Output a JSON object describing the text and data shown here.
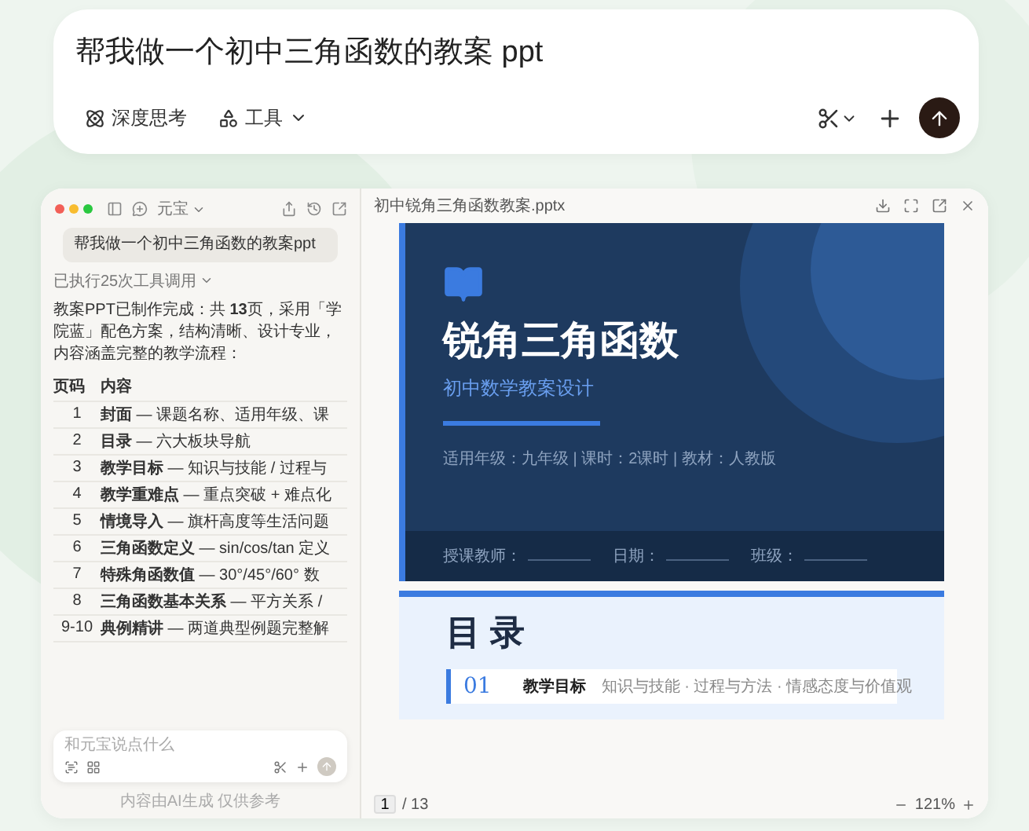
{
  "prompt": {
    "value": "帮我做一个初中三角函数的教案 ppt",
    "tools": [
      {
        "kind": "toggle",
        "label": "深度思考"
      },
      {
        "kind": "menu",
        "label": "工具"
      }
    ]
  },
  "chat": {
    "app_label": "元宝",
    "message": "帮我做一个初中三角函数的教案ppt",
    "tool_calls": "已执行25次工具调用",
    "summary": "教案PPT已制作完成：共 **13**页，采用「学院蓝」配色方案，结构清晰、设计专业，内容涵盖完整的教学流程：",
    "columns": [
      "页码",
      "内容"
    ],
    "rows": [
      {
        "page": "1",
        "title": "封面",
        "detail": " — 课题名称、适用年级、课"
      },
      {
        "page": "2",
        "title": "目录",
        "detail": " — 六大板块导航"
      },
      {
        "page": "3",
        "title": "教学目标",
        "detail": " — 知识与技能 / 过程与"
      },
      {
        "page": "4",
        "title": "教学重难点",
        "detail": " — 重点突破 + 难点化"
      },
      {
        "page": "5",
        "title": "情境导入",
        "detail": " — 旗杆高度等生活问题"
      },
      {
        "page": "6",
        "title": "三角函数定义",
        "detail": " — sin/cos/tan 定义"
      },
      {
        "page": "7",
        "title": "特殊角函数值",
        "detail": " — 30°/45°/60° 数"
      },
      {
        "page": "8",
        "title": "三角函数基本关系",
        "detail": " — 平方关系 /"
      },
      {
        "page": "9-10",
        "title": "典例精讲",
        "detail": " — 两道典型例题完整解"
      }
    ],
    "input": {
      "placeholder": "和元宝说点什么"
    },
    "footnote": "内容由AI生成 仅供参考"
  },
  "preview": {
    "filename": "初中锐角三角函数教案.pptx",
    "slides": [
      {
        "kind": "cover",
        "title": "锐角三角函数",
        "subtitle": "初中数学教案设计",
        "meta": "适用年级：九年级 | 课时：2课时 | 教材：人教版",
        "fields": [
          "授课教师：",
          "日期：",
          "班级："
        ]
      },
      {
        "kind": "contents",
        "title": "目 录",
        "items": [
          {
            "number": "01",
            "title": "教学目标",
            "detail": "知识与技能 · 过程与方法 · 情感态度与价值观"
          }
        ]
      }
    ],
    "page": "1",
    "page_total": "/ 13",
    "zoom": "121%"
  }
}
